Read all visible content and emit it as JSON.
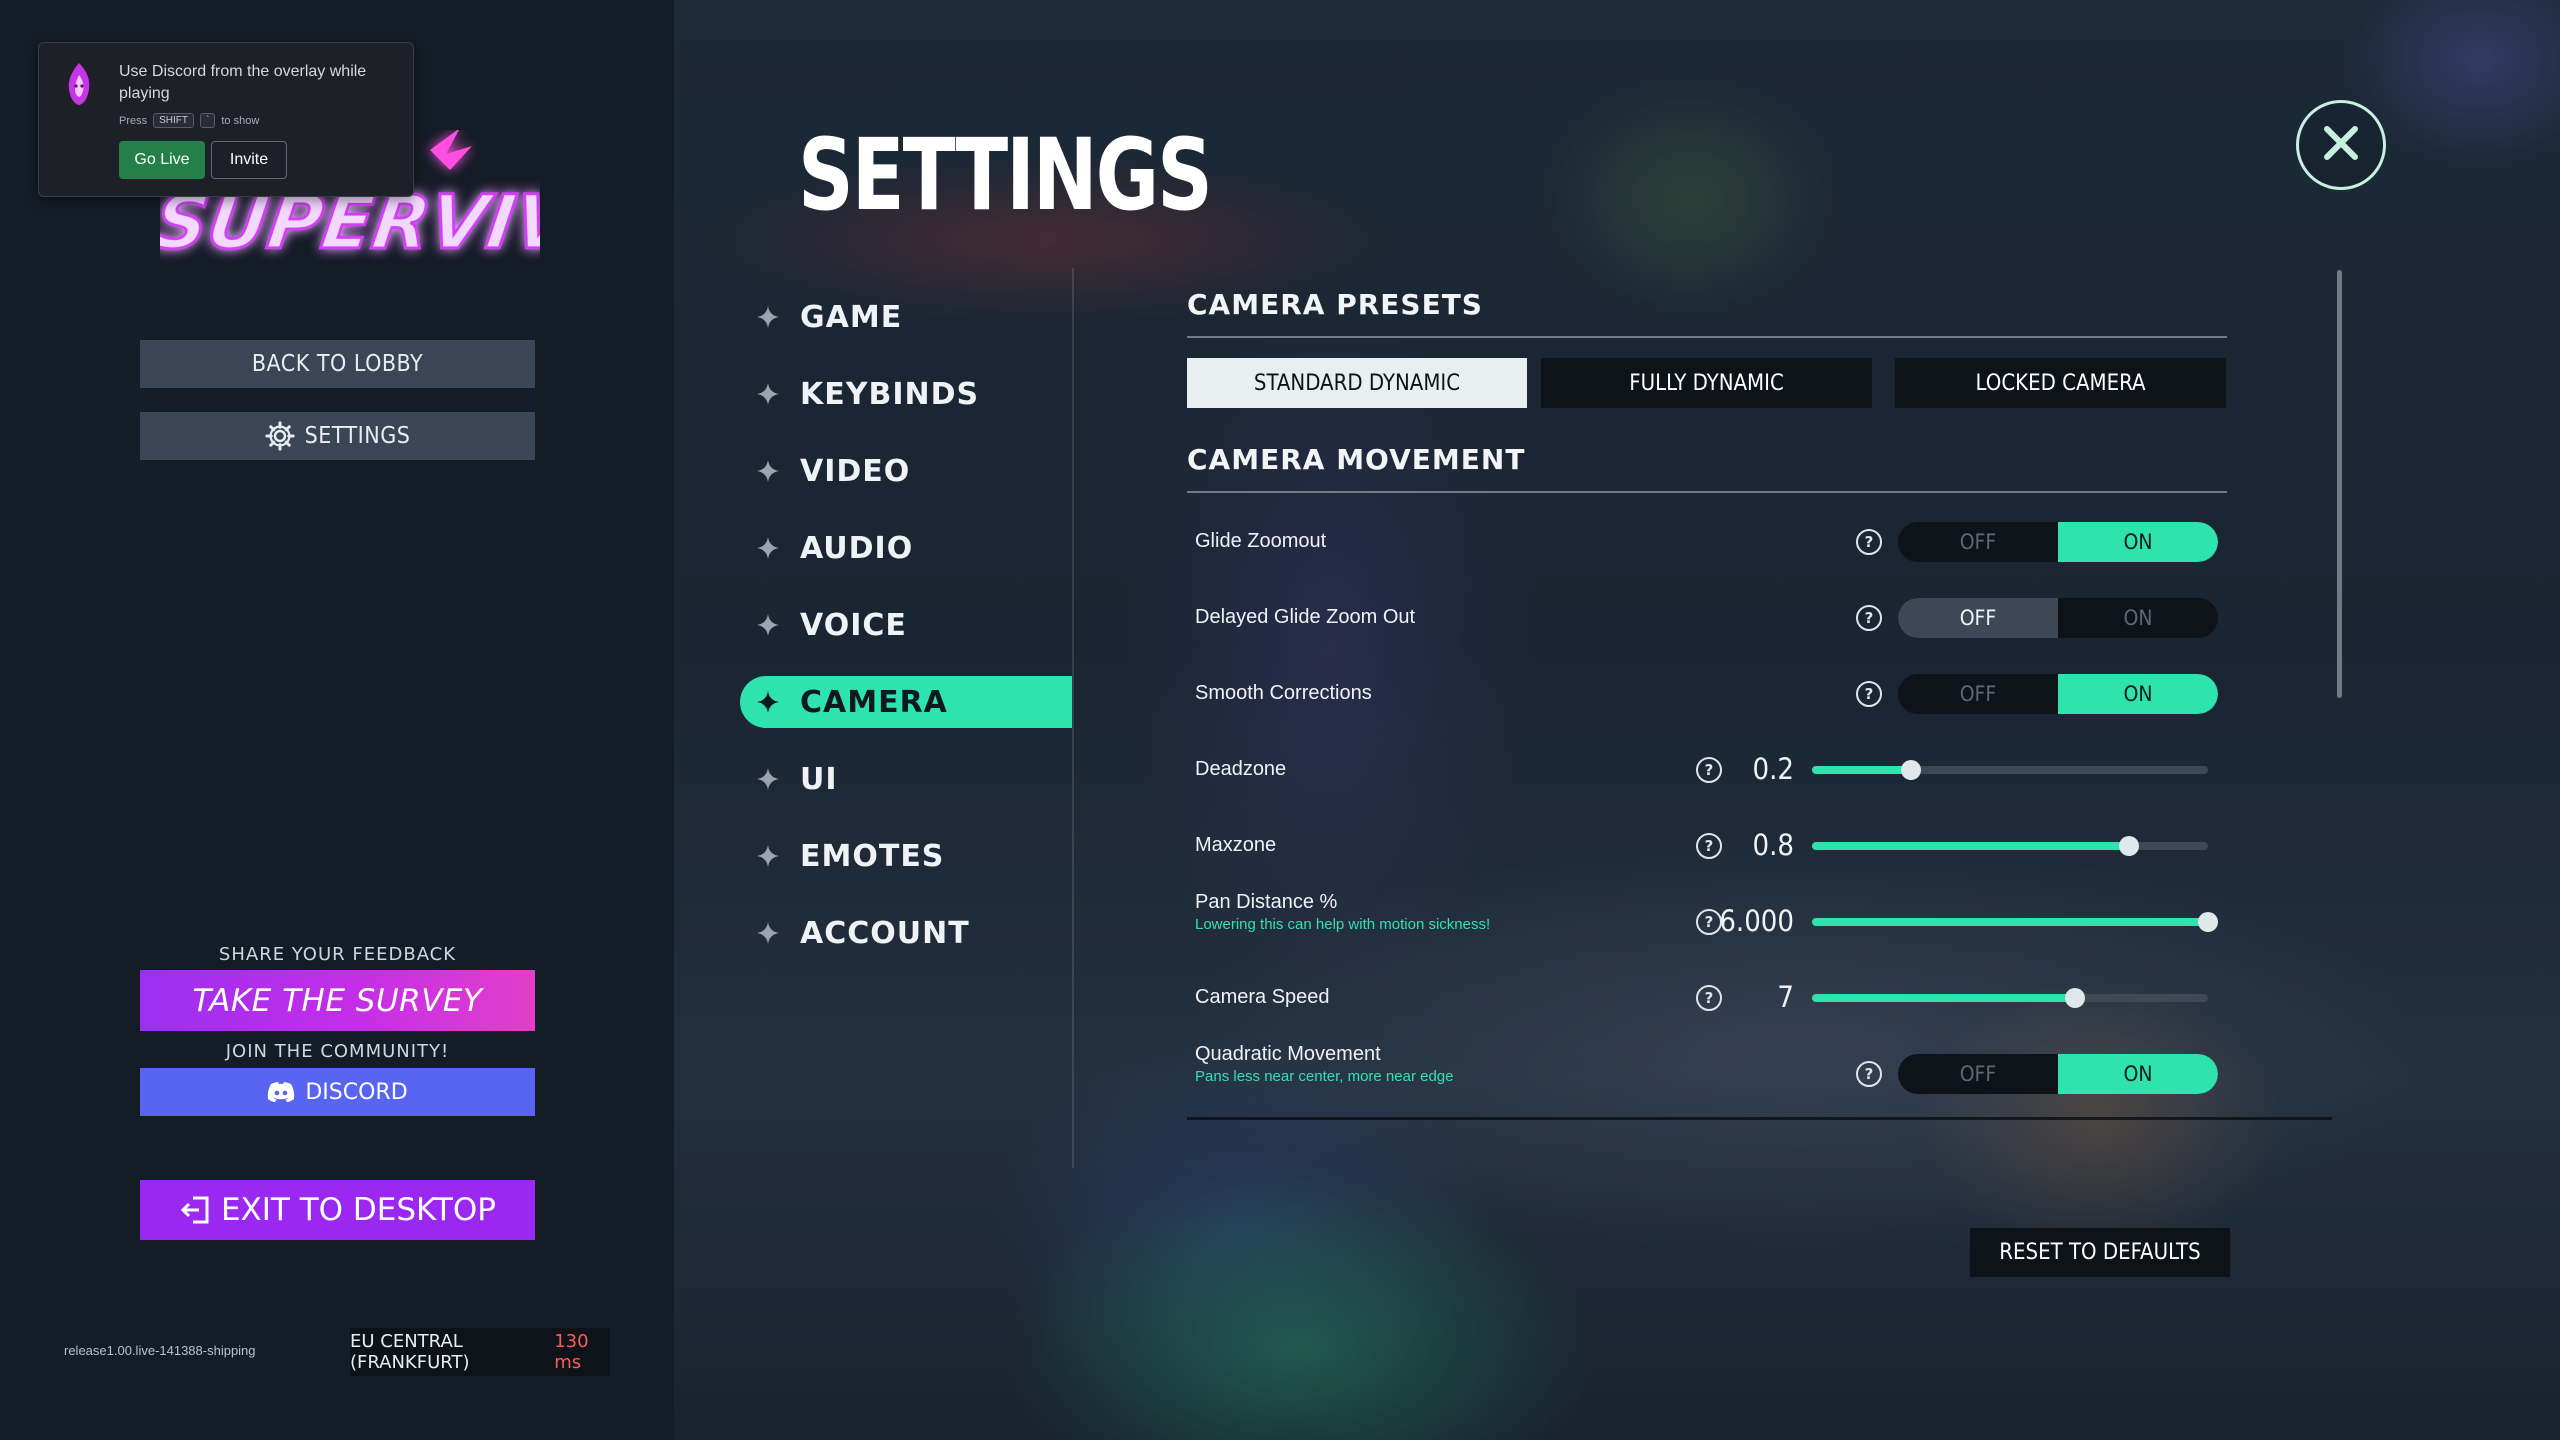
{
  "overlay": {
    "message": "Use Discord from the overlay while playing",
    "hint_prefix": "Press",
    "hint_key1": "SHIFT",
    "hint_key2": "`",
    "hint_suffix": "to show",
    "go_live": "Go Live",
    "invite": "Invite"
  },
  "left": {
    "logo_text": "SUPERVIVE",
    "back_to_lobby": "BACK TO LOBBY",
    "settings": "SETTINGS",
    "feedback_heading": "SHARE YOUR FEEDBACK",
    "survey_button": "TAKE THE SURVEY",
    "community_heading": "JOIN THE COMMUNITY!",
    "discord_button": "DISCORD",
    "exit_button": "EXIT TO DESKTOP",
    "build_version": "release1.00.live-141388-shipping",
    "server_name": "EU CENTRAL (FRANKFURT)",
    "server_ping": "130 ms"
  },
  "settings": {
    "title": "SETTINGS",
    "nav": [
      {
        "label": "GAME"
      },
      {
        "label": "KEYBINDS"
      },
      {
        "label": "VIDEO"
      },
      {
        "label": "AUDIO"
      },
      {
        "label": "VOICE"
      },
      {
        "label": "CAMERA",
        "active": true
      },
      {
        "label": "UI"
      },
      {
        "label": "EMOTES"
      },
      {
        "label": "ACCOUNT"
      }
    ],
    "presets_heading": "CAMERA PRESETS",
    "presets": [
      {
        "label": "STANDARD DYNAMIC",
        "selected": true
      },
      {
        "label": "FULLY DYNAMIC",
        "selected": false
      },
      {
        "label": "LOCKED CAMERA",
        "selected": false
      }
    ],
    "movement_heading": "CAMERA MOVEMENT",
    "toggle_off": "OFF",
    "toggle_on": "ON",
    "rows": [
      {
        "label": "Glide Zoomout",
        "type": "toggle",
        "value": "ON"
      },
      {
        "label": "Delayed Glide Zoom Out",
        "type": "toggle",
        "value": "OFF"
      },
      {
        "label": "Smooth Corrections",
        "type": "toggle",
        "value": "ON"
      },
      {
        "label": "Deadzone",
        "type": "slider",
        "value": "0.2",
        "fraction": 0.25
      },
      {
        "label": "Maxzone",
        "type": "slider",
        "value": "0.8",
        "fraction": 0.8
      },
      {
        "label": "Pan Distance %",
        "sublabel": "Lowering this can help with motion sickness!",
        "type": "slider",
        "value": "6.000",
        "fraction": 1.0
      },
      {
        "label": "Camera Speed",
        "type": "slider",
        "value": "7",
        "fraction": 0.665
      },
      {
        "label": "Quadratic Movement",
        "sublabel": "Pans less near center, more near edge",
        "type": "toggle",
        "value": "ON"
      }
    ],
    "help_glyph": "?",
    "reset_button": "RESET TO DEFAULTS"
  },
  "colors": {
    "accent": "#2ee3ae",
    "survey_gradient_start": "#9b2ff0",
    "survey_gradient_end": "#e33fc9",
    "discord": "#5865f2",
    "exit": "#9a28f0",
    "ping": "#ff5a5a"
  },
  "icons": {
    "close": "close-icon",
    "nav_bullet": "sparkle-icon",
    "settings": "gear-icon",
    "discord": "discord-icon",
    "exit": "exit-icon",
    "help": "help-icon"
  }
}
